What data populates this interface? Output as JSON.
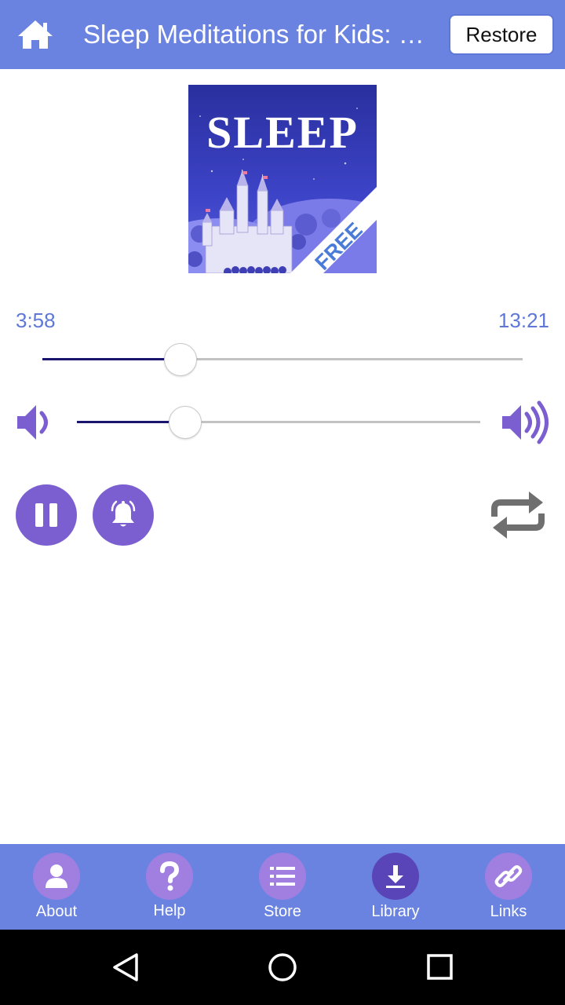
{
  "header": {
    "title": "Sleep Meditations for Kids: Bedtime Stories for Children",
    "restore_label": "Restore",
    "home_icon": "home-icon",
    "background": "#6b83e0"
  },
  "cover": {
    "heading": "SLEEP",
    "ribbon": "FREE"
  },
  "player": {
    "elapsed": "3:58",
    "duration": "13:21",
    "progress_fraction": 0.297,
    "volume_fraction": 0.27,
    "accent": "#7b5fd0",
    "track_fill_color": "#1a1670",
    "pause_icon": "pause-icon",
    "alarm_icon": "alarm-bell-icon",
    "repeat_icon": "repeat-icon",
    "volume_low_icon": "volume-low-icon",
    "volume_high_icon": "volume-high-icon"
  },
  "bottom_nav": {
    "items": [
      {
        "label": "About",
        "icon": "person-icon"
      },
      {
        "label": "Help",
        "icon": "question-icon"
      },
      {
        "label": "Store",
        "icon": "list-icon"
      },
      {
        "label": "Library",
        "icon": "download-icon"
      },
      {
        "label": "Links",
        "icon": "link-icon"
      }
    ]
  },
  "system_nav": {
    "back_icon": "back-triangle-icon",
    "home_icon": "home-circle-icon",
    "recents_icon": "recents-square-icon"
  }
}
